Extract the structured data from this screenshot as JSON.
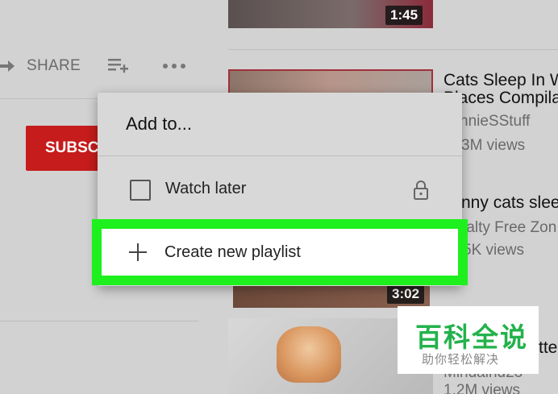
{
  "watch_page": {
    "share_label": "SHARE",
    "subscribe_label": "SUBSCRIBE"
  },
  "sidebar": {
    "videos": [
      {
        "duration": "1:45"
      },
      {
        "title_line1": "Cats Sleep In W",
        "title_line2": "Places Compila",
        "channel": "nnieSStuff",
        "views": "3M views"
      },
      {
        "title_line1": "nny cats slee",
        "channel": "ralty Free Zon",
        "views": "5K views",
        "duration": "3:02"
      },
      {
        "title_line1": "tte",
        "channel": "Mindaind23",
        "views": "1.2M views"
      }
    ]
  },
  "dialog": {
    "title": "Add to...",
    "watch_later_label": "Watch later",
    "create_playlist_label": "Create new playlist"
  },
  "watermark": {
    "title": "百科全说",
    "subtitle": "助你轻松解决"
  },
  "colors": {
    "highlight": "#1ef01e",
    "subscribe": "#c61c1c"
  }
}
